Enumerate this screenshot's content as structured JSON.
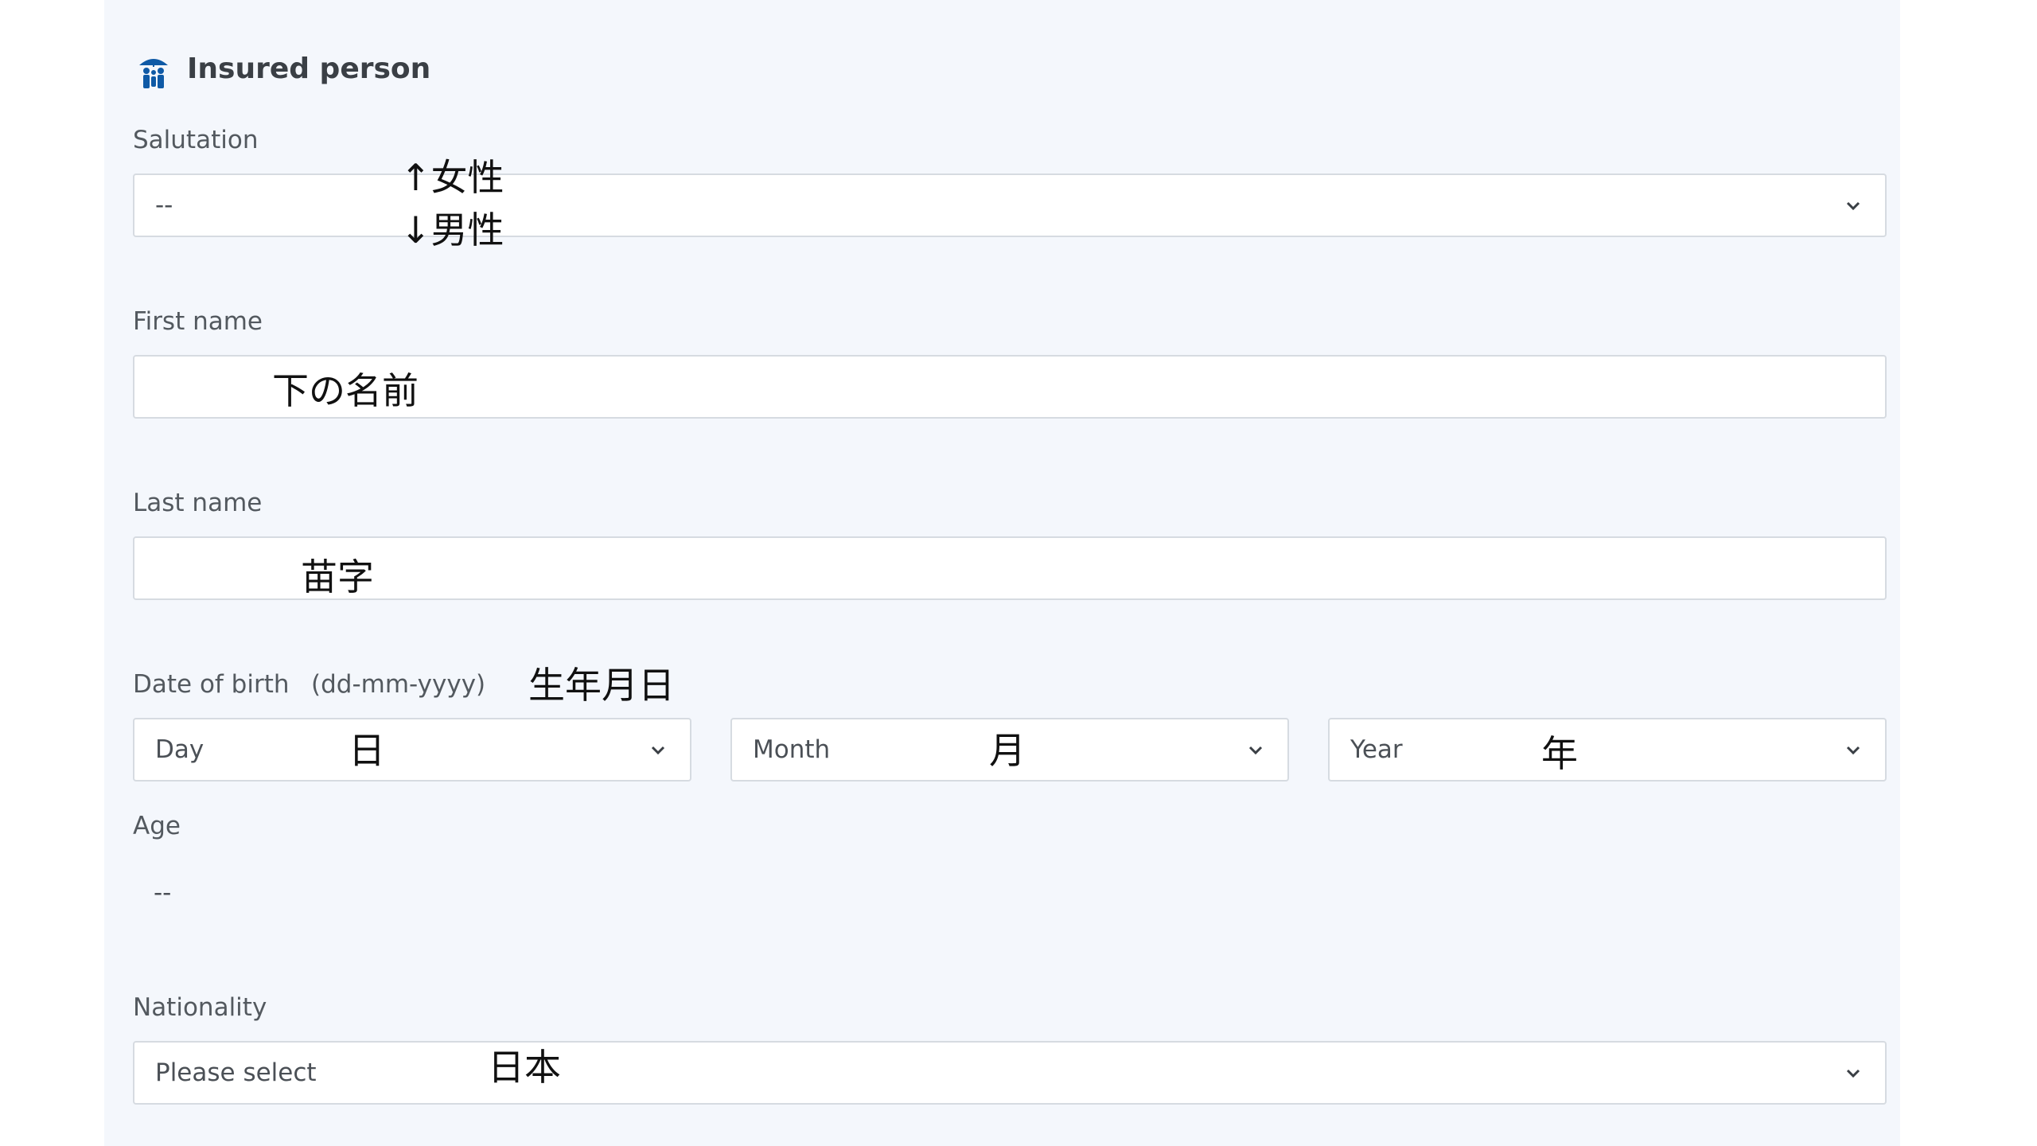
{
  "section": {
    "title": "Insured person",
    "icon": "people-umbrella-icon"
  },
  "salutation": {
    "label": "Salutation",
    "value": "--",
    "icon": "chevron-down-icon"
  },
  "first_name": {
    "label": "First name",
    "value": ""
  },
  "last_name": {
    "label": "Last name",
    "value": ""
  },
  "date_of_birth": {
    "label": "Date of birth",
    "format_hint": "(dd-mm-yyyy)",
    "day_placeholder": "Day",
    "month_placeholder": "Month",
    "year_placeholder": "Year"
  },
  "age": {
    "label": "Age",
    "value": "--"
  },
  "nationality": {
    "label": "Nationality",
    "value": "Please select"
  },
  "annotations": {
    "salutation_up": "↑女性",
    "salutation_down": "↓男性",
    "first_name": "下の名前",
    "last_name": "苗字",
    "date_of_birth": "生年月日",
    "day": "日",
    "month": "月",
    "year": "年",
    "nationality": "日本"
  },
  "colors": {
    "panel_bg": "#f4f7fc",
    "accent": "#0f5aa6",
    "border": "#d6dbe1"
  }
}
